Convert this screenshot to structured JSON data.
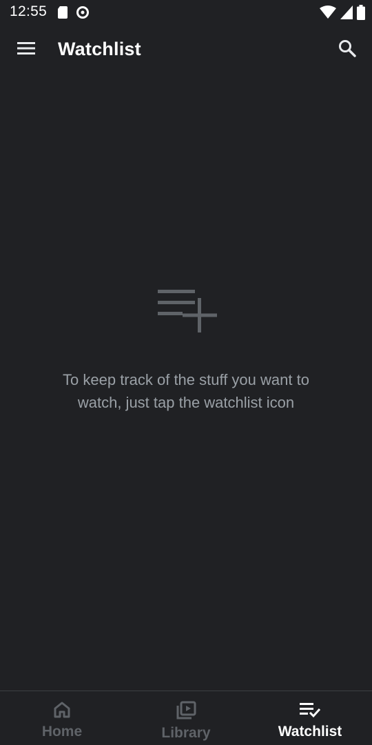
{
  "status_bar": {
    "time": "12:55",
    "icons": [
      "sd-card-icon",
      "data-saver-icon",
      "wifi-icon",
      "signal-icon",
      "battery-icon"
    ]
  },
  "app_bar": {
    "title": "Watchlist",
    "menu_icon": "hamburger-menu-icon",
    "search_icon": "search-icon"
  },
  "empty_state": {
    "icon": "playlist-add-icon",
    "message": "To keep track of the stuff you want to watch, just tap the watchlist icon"
  },
  "bottom_nav": {
    "items": [
      {
        "label": "Home",
        "icon": "home-icon",
        "active": false
      },
      {
        "label": "Library",
        "icon": "library-icon",
        "active": false
      },
      {
        "label": "Watchlist",
        "icon": "watchlist-icon",
        "active": true
      }
    ]
  },
  "colors": {
    "background": "#202124",
    "text_primary": "#ffffff",
    "text_secondary": "#9aa0a6",
    "nav_inactive": "#5f6368"
  }
}
